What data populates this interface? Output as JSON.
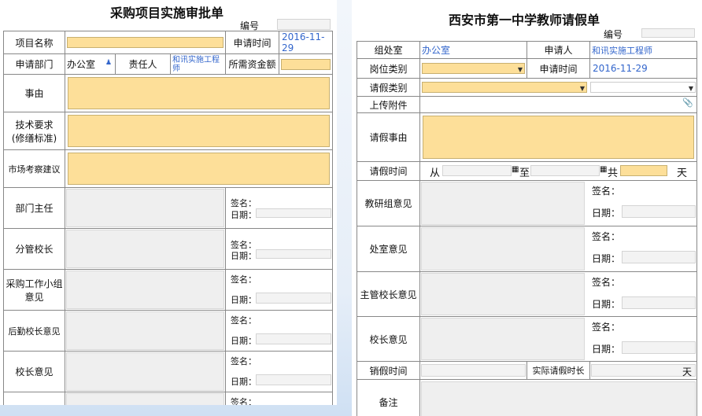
{
  "left_form": {
    "title": "采购项目实施审批单",
    "number_label": "编号",
    "item_name_label": "项目名称",
    "apply_time_label": "申请时间",
    "apply_time_value": "2016-11-29",
    "dept_label": "申请部门",
    "dept_value": "办公室",
    "owner_label": "责任人",
    "owner_value": "和讯实施工程师",
    "funds_label": "所需资金额",
    "reason_label": "事由",
    "tech_label_1": "技术要求",
    "tech_label_2": "(修缮标准)",
    "market_label": "市场考察建议",
    "sign_label": "签名：",
    "date_label": "日期：",
    "opinions": [
      {
        "label_1": "部门主任",
        "label_2": ""
      },
      {
        "label_1": "分管校长",
        "label_2": ""
      },
      {
        "label_1": "采购工作小组",
        "label_2": "意见"
      },
      {
        "label_1": "后勤校长意见",
        "label_2": ""
      },
      {
        "label_1": "校长意见",
        "label_2": ""
      },
      {
        "label_1": "",
        "label_2": ""
      }
    ]
  },
  "right_form": {
    "title": "西安市第一中学教师请假单",
    "number_label": "编号",
    "dept_label": "组处室",
    "dept_value": "办公室",
    "applicant_label": "申请人",
    "applicant_value": "和讯实施工程师",
    "post_label": "岗位类别",
    "apply_time_label": "申请时间",
    "apply_time_value": "2016-11-29",
    "leave_type_label": "请假类别",
    "attach_label": "上传附件",
    "leave_reason_label": "请假事由",
    "leave_time_label": "请假时间",
    "from_label": "从",
    "to_label": "至",
    "total_label": "共",
    "days_label": "天",
    "sign_label": "签名：",
    "date_label": "日期：",
    "opinions": [
      {
        "label": "教研组意见"
      },
      {
        "label": "处室意见"
      },
      {
        "label": "主管校长意见"
      },
      {
        "label": "校长意见"
      }
    ],
    "cancel_time_label": "销假时间",
    "actual_days_label": "实际请假时长",
    "actual_days_unit": "天",
    "remark_label": "备注"
  },
  "icons": {
    "calendar": "calendar-icon",
    "dropdown": "chevron-down-icon",
    "person_picker": "person-picker-icon",
    "paperclip": "paperclip-icon"
  },
  "colors": {
    "field_yellow": "#fddf99",
    "link_blue": "#3366cc",
    "grid_border": "#888888"
  }
}
